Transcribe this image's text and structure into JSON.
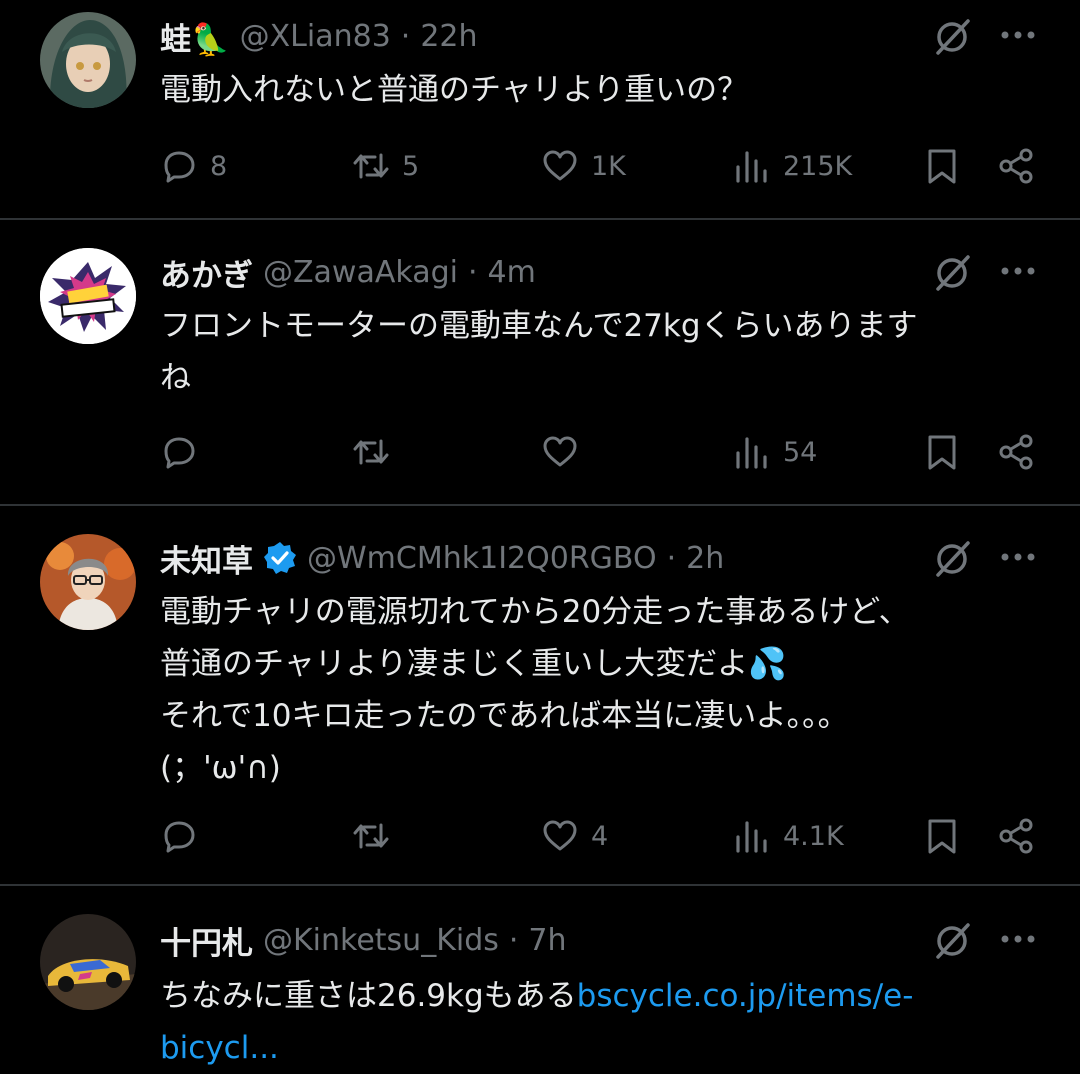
{
  "colors": {
    "background": "#000000",
    "text": "#e7e9ea",
    "muted": "#71767b",
    "link": "#1d9bf0",
    "verified": "#1d9bf0",
    "divider": "#2f3336"
  },
  "tweets": [
    {
      "name": "蛙🦜",
      "handle": "@XLian83",
      "time": "22h",
      "verified": false,
      "lines": [
        "電動入れないと普通のチャリより重いの？"
      ],
      "link": "",
      "replies": "8",
      "retweets": "5",
      "likes": "1K",
      "views": "215K"
    },
    {
      "name": "あかぎ",
      "handle": "@ZawaAkagi",
      "time": "4m",
      "verified": false,
      "lines": [
        "フロントモーターの電動車なんで27kgくらいあります",
        "ね"
      ],
      "link": "",
      "replies": "",
      "retweets": "",
      "likes": "",
      "views": "54"
    },
    {
      "name": "未知草",
      "handle": "@WmCMhk1I2Q0RGBO",
      "time": "2h",
      "verified": true,
      "lines": [
        "電動チャリの電源切れてから20分走った事あるけど、",
        "普通のチャリより凄まじく重いし大変だよ💦",
        "それで10キロ走ったのであれば本当に凄いよ。。。",
        "(；'ω'∩)"
      ],
      "link": "",
      "replies": "",
      "retweets": "",
      "likes": "4",
      "views": "4.1K"
    },
    {
      "name": "十円札",
      "handle": "@Kinketsu_Kids",
      "time": "7h",
      "verified": false,
      "lines": [
        "ちなみに重さは26.9kgもある"
      ],
      "link": "bscycle.co.jp/items/e-bicycl...",
      "replies": "",
      "retweets": "",
      "likes": "",
      "views": ""
    }
  ],
  "separator": "·",
  "icons": [
    "grok-icon",
    "more-icon",
    "reply-icon",
    "retweet-icon",
    "like-icon",
    "views-icon",
    "bookmark-icon",
    "share-icon",
    "verified-badge-icon"
  ]
}
